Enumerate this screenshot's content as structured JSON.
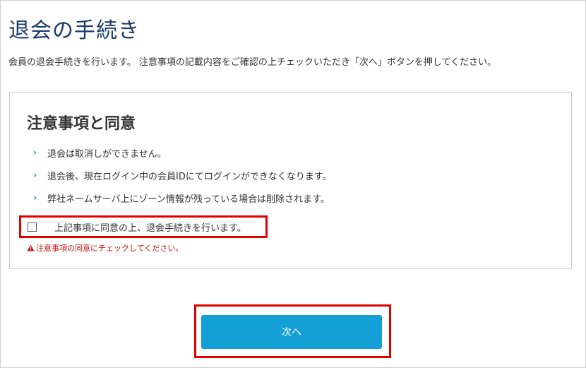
{
  "page": {
    "title": "退会の手続き",
    "intro": "会員の退会手続きを行います。 注意事項の記載内容をご確認の上チェックいただき「次へ」ボタンを押してください。"
  },
  "panel": {
    "title": "注意事項と同意",
    "items": [
      {
        "label": "退会は取消しができません。"
      },
      {
        "label": "退会後、現在ログイン中の会員IDにてログインができなくなります。"
      },
      {
        "label": "弊社ネームサーバ上にゾーン情報が残っている場合は削除されます。"
      }
    ],
    "bullet_icon": "chevron-right-icon",
    "agree": {
      "label": "上記事項に同意の上、退会手続きを行います。",
      "checked": false
    },
    "error": {
      "icon": "warning-icon",
      "text": "注意事項の同意にチェックしてください。"
    }
  },
  "actions": {
    "next_label": "次へ"
  },
  "colors": {
    "title": "#1a3a6b",
    "accent": "#14a0d6",
    "highlight": "#e10000",
    "error": "#cc1111"
  }
}
